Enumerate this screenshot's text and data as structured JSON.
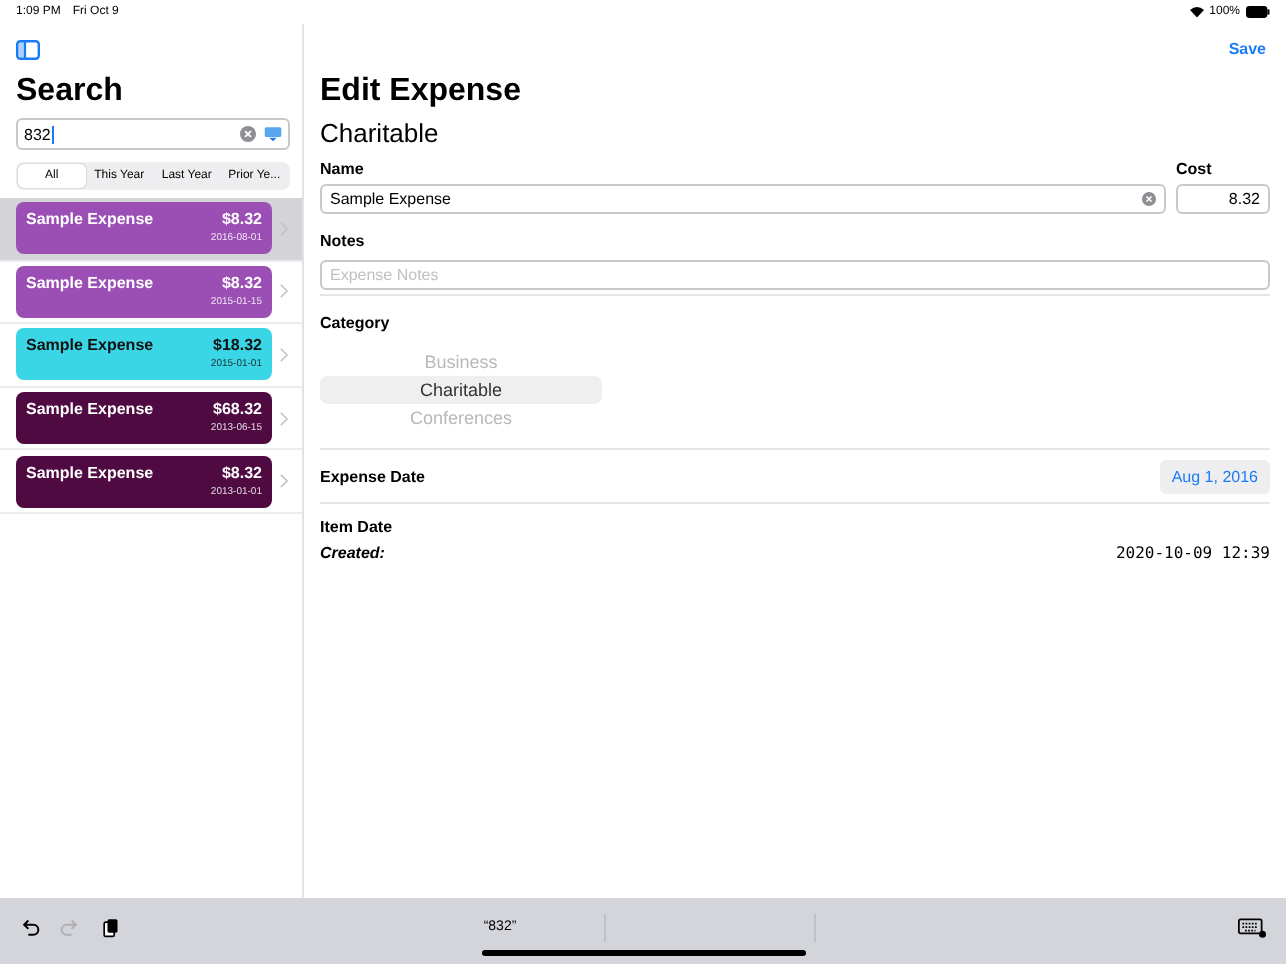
{
  "status_bar": {
    "time": "1:09 PM",
    "date": "Fri Oct 9",
    "battery": "100%"
  },
  "sidebar": {
    "title": "Search",
    "search": {
      "value": "832"
    },
    "segments": [
      {
        "label": "All",
        "selected": true
      },
      {
        "label": "This Year",
        "selected": false
      },
      {
        "label": "Last Year",
        "selected": false
      },
      {
        "label": "Prior Ye...",
        "selected": false
      }
    ],
    "expenses": [
      {
        "name": "Sample Expense",
        "amount": "$8.32",
        "date": "2016-08-01",
        "color": "#9b4fb5",
        "selected": true
      },
      {
        "name": "Sample Expense",
        "amount": "$8.32",
        "date": "2015-01-15",
        "color": "#9b4fb5",
        "selected": false
      },
      {
        "name": "Sample Expense",
        "amount": "$18.32",
        "date": "2015-01-01",
        "color": "#3ad6e6",
        "selected": false
      },
      {
        "name": "Sample Expense",
        "amount": "$68.32",
        "date": "2013-06-15",
        "color": "#4e0a41",
        "selected": false
      },
      {
        "name": "Sample Expense",
        "amount": "$8.32",
        "date": "2013-01-01",
        "color": "#4e0a41",
        "selected": false
      }
    ]
  },
  "detail": {
    "save": "Save",
    "title": "Edit Expense",
    "subtitle": "Charitable",
    "name_label": "Name",
    "name_value": "Sample Expense",
    "cost_label": "Cost",
    "cost_value": "8.32",
    "notes_label": "Notes",
    "notes_placeholder": "Expense Notes",
    "category_label": "Category",
    "categories": [
      {
        "label": "Business",
        "selected": false
      },
      {
        "label": "Charitable",
        "selected": true
      },
      {
        "label": "Conferences",
        "selected": false
      }
    ],
    "expense_date_label": "Expense Date",
    "expense_date": "Aug 1, 2016",
    "item_date_label": "Item Date",
    "created_label": "Created:",
    "created_value": "2020-10-09 12:39"
  },
  "keyboard_bar": {
    "suggestion": "“832”",
    "redo_disabled": true
  }
}
